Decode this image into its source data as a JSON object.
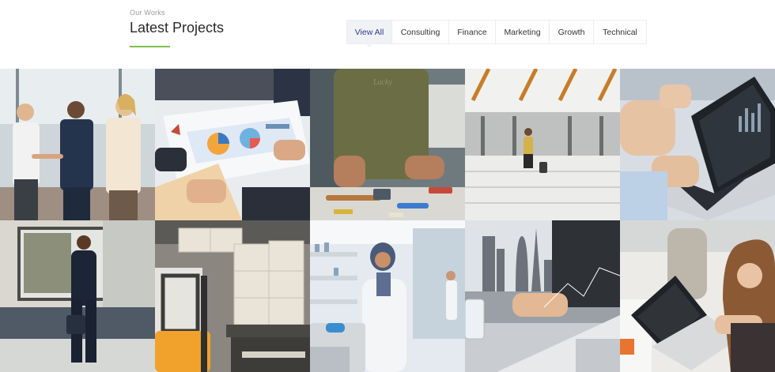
{
  "section": {
    "eyebrow": "Our Works",
    "title": "Latest Projects",
    "accent_color": "#7cc04b"
  },
  "filters": [
    {
      "label": "View All",
      "active": true
    },
    {
      "label": "Consulting",
      "active": false
    },
    {
      "label": "Finance",
      "active": false
    },
    {
      "label": "Marketing",
      "active": false
    },
    {
      "label": "Growth",
      "active": false
    },
    {
      "label": "Technical",
      "active": false
    }
  ],
  "projects": [
    {
      "subject": "business-handshake"
    },
    {
      "subject": "financial-charts-paperwork"
    },
    {
      "subject": "tools-on-workbench"
    },
    {
      "subject": "traveler-in-terminal"
    },
    {
      "subject": "laptop-analytics"
    },
    {
      "subject": "businessman-walking"
    },
    {
      "subject": "warehouse-forklift"
    },
    {
      "subject": "laboratory-scientist"
    },
    {
      "subject": "city-skyline-finance"
    },
    {
      "subject": "woman-using-laptop"
    }
  ]
}
